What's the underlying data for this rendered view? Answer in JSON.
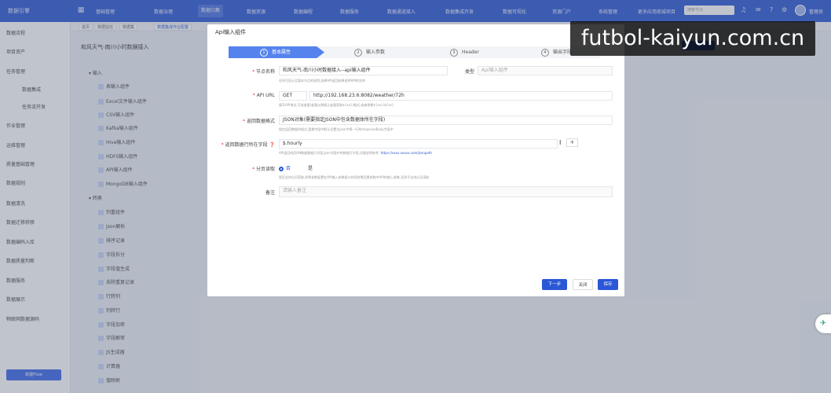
{
  "topbar": {
    "logo": "数据引擎",
    "nav": [
      "基础管理",
      "数据治理",
      "数据归集",
      "数据资源",
      "数据编程",
      "数据服务",
      "数据通道接入",
      "数据集成开发",
      "数据可视化",
      "资源门户",
      "系统管理",
      "更多应用商城项目"
    ],
    "search_placeholder": "搜索节点",
    "user": "管理员"
  },
  "sidebar": {
    "items": [
      "数据流程",
      "项目资产",
      "任务管理",
      "数据集成",
      "任务流开发",
      "作业管理",
      "运维管理",
      "质量基础管理",
      "数据规则",
      "数据清洗",
      "数据迁移转移",
      "数据编码入库",
      "数据质量判断",
      "数据服务",
      "数据展示",
      "物联网数据源码"
    ],
    "new_button": "新建Flow"
  },
  "tabs": [
    "首页",
    "数据监控",
    "数据集",
    "数据集成作业配置"
  ],
  "page_title": "和风天气-南川小时数据接入",
  "tree": {
    "group1": "输入",
    "inputs": [
      "表输入组件",
      "Excel文件输入组件",
      "CSV输入组件",
      "Kafka输入组件",
      "Hive输入组件",
      "HDFS输入组件",
      "API输入组件",
      "MongoDB输入组件"
    ],
    "group2": "转换",
    "transforms": [
      "列重组件",
      "Json解析",
      "排序记录",
      "字段拆分",
      "字段值生成",
      "去除重复记录",
      "行转列",
      "列转行",
      "字段加密",
      "字段解密",
      "JS生成器",
      "计算器",
      "值映射"
    ]
  },
  "modal": {
    "title": "Api输入组件",
    "steps": [
      {
        "num": "1",
        "label": "基本属性"
      },
      {
        "num": "2",
        "label": "输入参数"
      },
      {
        "num": "3",
        "label": "Header"
      },
      {
        "num": "4",
        "label": "输出字段"
      }
    ],
    "node_name_label": "节点名称",
    "node_name_value": "和风天气-南川小时数据接入--api输入组件",
    "type_label": "类型",
    "type_value": "Api输入组件",
    "node_name_hint": "任何可显示且版本节点的说明,选择API返回结果说明API的名称",
    "api_url_label": "API URL",
    "method": "GET",
    "url": "http://192.168.23.6:8082/weather/72h",
    "api_url_hint": "填写API地址,可选变量(变量从数据元变量获取${xx})格式,或者参数${xx}/${xx}",
    "format_label": "返回数据格式",
    "format_value": "JSON对象(需要指定JSON中包含数据体所在字段)",
    "format_hint": "指定返回数据的格式,暂需字段中默认设置为json中第一行的responseBody字段中",
    "field_label": "返回数据行所在字段",
    "field_value": "$.hourly",
    "field_hint": "API返回的JSON数据数据行字段,Json字段中的数据行字段,详细说明参考:",
    "field_hint_link": "https://xxxx.xxxxx.com/jsonpath",
    "paging_label": "分页读取",
    "paging_options": [
      "否",
      "是"
    ],
    "paging_hint": "是否支持分页获取,如将参数配置在API输入参数接口的同时需设置参数中API的输入参数,否则不支持分页读取",
    "remark_label": "备注",
    "remark_placeholder": "请输入备注",
    "buttons": {
      "next": "下一步",
      "close": "关闭",
      "save": "保存"
    }
  },
  "watermark": "futbol-kaiyun.com.cn",
  "colors": {
    "brand": "#2b57d6",
    "step_active": "#5583ee"
  }
}
